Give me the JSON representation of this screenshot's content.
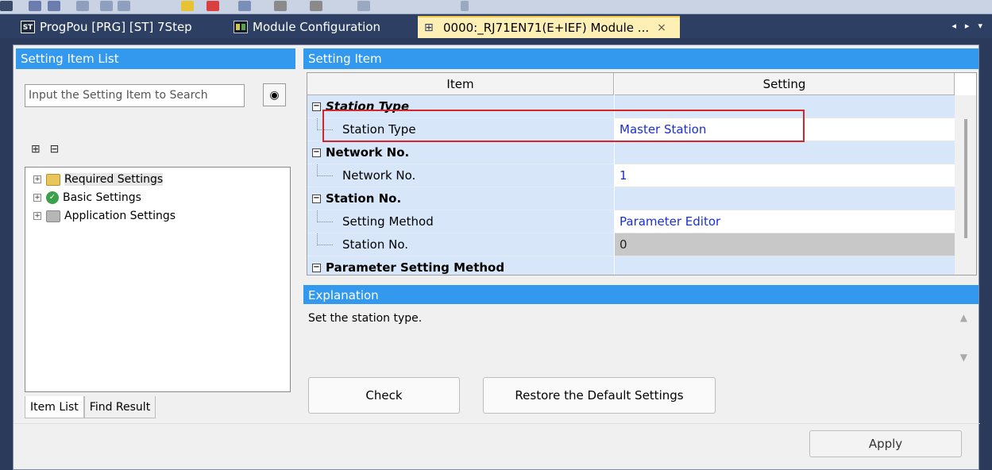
{
  "toolbar": {
    "icons": [
      "grid-icon",
      "undo-icon",
      "redo-icon",
      "cut-icon",
      "copy-icon",
      "paste-icon",
      "check-icon",
      "convert-icon",
      "view-icon",
      "find-icon",
      "zoom-icon",
      "print-icon",
      "overflow-icon"
    ]
  },
  "tabs": [
    {
      "label": "ProgPou [PRG] [ST] 7Step",
      "icon": "st-icon"
    },
    {
      "label": "Module Configuration",
      "icon": "module-config-icon"
    },
    {
      "label": "0000:_RJ71EN71(E+IEF) Module ...",
      "icon": "network-module-icon",
      "close": "×"
    }
  ],
  "tab_scroll": "◂ ▸ ▾",
  "left_panel": {
    "title": "Setting Item List",
    "search_placeholder": "Input the Setting Item to Search",
    "tree": [
      {
        "label": "Required Settings",
        "icon": "folder-required-icon"
      },
      {
        "label": "Basic Settings",
        "icon": "folder-basic-check-icon"
      },
      {
        "label": "Application Settings",
        "icon": "folder-application-icon"
      }
    ],
    "bottom_tabs": [
      "Item List",
      "Find Result"
    ]
  },
  "right_panel": {
    "title": "Setting Item",
    "columns": {
      "item": "Item",
      "setting": "Setting"
    },
    "rows": [
      {
        "type": "category",
        "item": "Station Type",
        "setting": ""
      },
      {
        "type": "child",
        "item": "Station Type",
        "setting": "Master Station"
      },
      {
        "type": "category",
        "item": "Network No.",
        "setting": ""
      },
      {
        "type": "child",
        "item": "Network No.",
        "setting": "1"
      },
      {
        "type": "category",
        "item": "Station No.",
        "setting": ""
      },
      {
        "type": "child",
        "item": "Setting Method",
        "setting": "Parameter Editor"
      },
      {
        "type": "child",
        "item": "Station No.",
        "setting": "0"
      },
      {
        "type": "category",
        "item": "Parameter Setting Method",
        "setting": ""
      }
    ],
    "explanation_title": "Explanation",
    "explanation_text": "Set the station type.",
    "buttons": {
      "check": "Check",
      "restore": "Restore the Default Settings",
      "apply": "Apply"
    }
  },
  "colors": {
    "header_blue": "#3399ee",
    "value_blue": "#1a2fd6",
    "highlight_red": "#d4262a"
  }
}
